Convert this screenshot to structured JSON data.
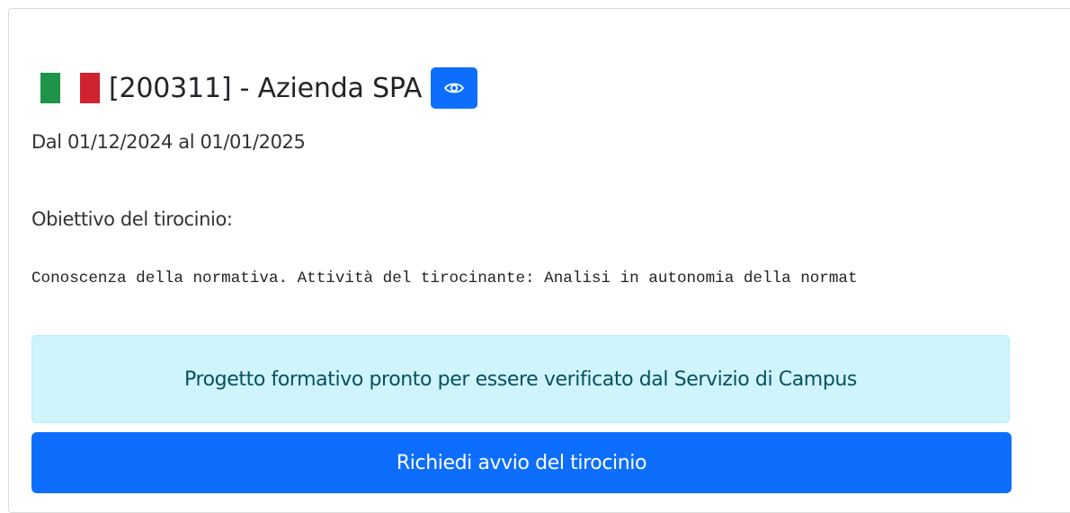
{
  "internship": {
    "title": "[200311] - Azienda SPA",
    "dates": "Dal 01/12/2024 al 01/01/2025",
    "objective_label": "Obiettivo del tirocinio:",
    "objective_text": "Conoscenza della normativa. Attività del tirocinante: Analisi in autonomia della normat"
  },
  "status": {
    "message": "Progetto formativo pronto per essere verificato dal Servizio di Campus"
  },
  "actions": {
    "request_start_label": "Richiedi avvio del tirocinio"
  },
  "icons": {
    "view": "eye-icon",
    "flag": "italy-flag-icon"
  },
  "colors": {
    "primary": "#0d6efd",
    "alert_bg": "#cff4fc",
    "alert_text": "#055160",
    "flag_green": "#1e9448",
    "flag_red": "#d1232f"
  }
}
